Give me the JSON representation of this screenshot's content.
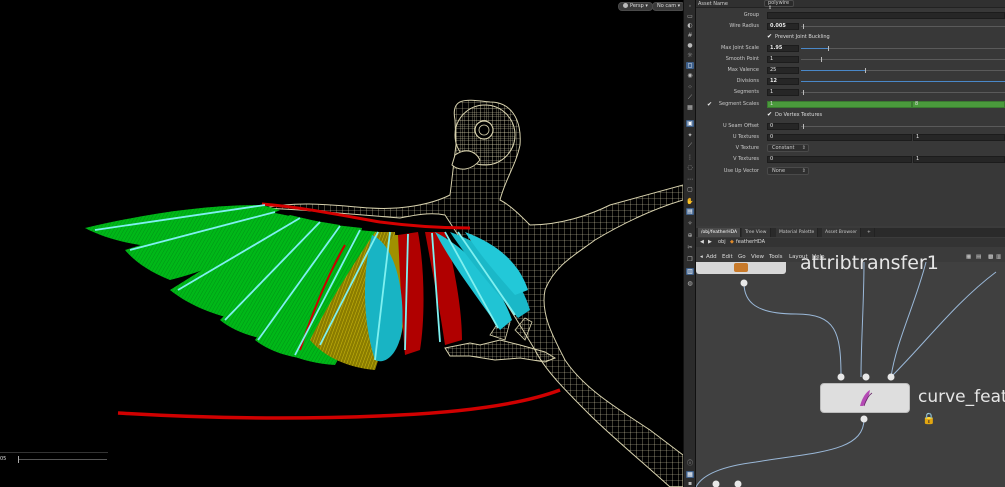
{
  "viewport": {
    "persp_label": "Persp",
    "cam_label": "No cam",
    "slider_value": "05",
    "colors": {
      "wireframe": "#d8d2ae",
      "green": "#00c21a",
      "yellow": "#c8b400",
      "red": "#cc0000",
      "cyan": "#1ec8d8",
      "curve": "#d00000"
    }
  },
  "params": {
    "asset_name_label": "Asset Name",
    "asset_name_value": "polywire",
    "group_label": "Group",
    "wire_radius_label": "Wire Radius",
    "wire_radius_value": "0.005",
    "prevent_buckling_label": "Prevent Joint Buckling",
    "max_joint_scale_label": "Max Joint Scale",
    "max_joint_scale_value": "1.95",
    "smooth_point_label": "Smooth Point",
    "smooth_point_value": "1",
    "max_valence_label": "Max Valence",
    "max_valence_value": "25",
    "divisions_label": "Divisions",
    "divisions_value": "12",
    "segments_label": "Segments",
    "segments_value": "1",
    "segment_scales_label": "Segment Scales",
    "segment_scales_a": "1",
    "segment_scales_b": "8",
    "do_vertex_textures_label": "Do Vertex Textures",
    "u_seam_offset_label": "U Seam Offset",
    "u_seam_offset_value": "0",
    "u_textures_label": "U Textures",
    "u_textures_a": "0",
    "u_textures_b": "1",
    "v_texture_label": "V Texture",
    "v_texture_value": "Constant",
    "v_textures_label": "V Textures",
    "v_textures_a": "0",
    "v_textures_b": "1",
    "use_up_vector_label": "Use Up Vector",
    "use_up_vector_value": "None"
  },
  "network": {
    "tabs": [
      "/obj/featherHDA",
      "Tree View",
      "Material Palette",
      "Asset Browser"
    ],
    "path": {
      "root": "obj",
      "current": "featherHDA"
    },
    "menu": [
      "Add",
      "Edit",
      "Go",
      "View",
      "Tools",
      "Layout",
      "Help"
    ],
    "node_top_label": "attribtransfer1",
    "node_main_label": "curve_feat"
  }
}
